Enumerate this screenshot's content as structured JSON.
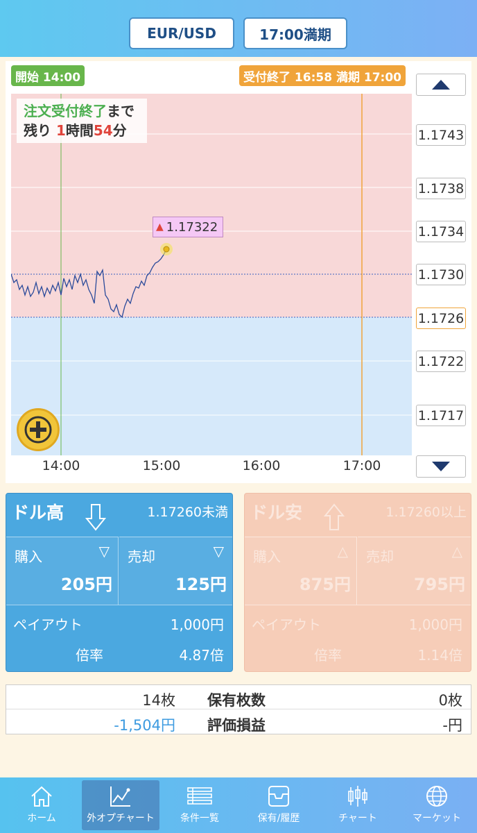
{
  "header": {
    "pair": "EUR/USD",
    "expiry": "17:00満期"
  },
  "chart": {
    "start_flag": "開始 14:00",
    "end_flag": "受付終了 16:58 満期 17:00",
    "remaining": {
      "part1": "注文受付終了",
      "part2": "まで",
      "part3": "残り",
      "hours": "1",
      "hours_unit": "時間",
      "minutes": "54",
      "minutes_unit": "分"
    },
    "current_price": "1.17322",
    "y_labels": [
      "1.1743",
      "1.1738",
      "1.1734",
      "1.1730",
      "1.1726",
      "1.1722",
      "1.1717"
    ],
    "x_labels": [
      "14:00",
      "15:00",
      "16:00",
      "17:00"
    ],
    "colors": {
      "above": "#f8d8d8",
      "below": "#d6e9fa",
      "line": "#2a4a9a",
      "start": "#68b64b",
      "end": "#f0a43a"
    }
  },
  "options": {
    "high": {
      "title": "ドル高",
      "condition": "1.17260未満",
      "buy_label": "購入",
      "buy_price": "205円",
      "sell_label": "売却",
      "sell_price": "125円",
      "payout_label": "ペイアウト",
      "payout_value": "1,000円",
      "ratio_label": "倍率",
      "ratio_value": "4.87倍"
    },
    "low": {
      "title": "ドル安",
      "condition": "1.17260以上",
      "buy_label": "購入",
      "buy_price": "875円",
      "sell_label": "売却",
      "sell_price": "795円",
      "payout_label": "ペイアウト",
      "payout_value": "1,000円",
      "ratio_label": "倍率",
      "ratio_value": "1.14倍"
    }
  },
  "holdings": {
    "left_count": "14枚",
    "count_label": "保有枚数",
    "right_count": "0枚",
    "left_pl": "-1,504円",
    "pl_label": "評価損益",
    "right_pl": "-円"
  },
  "nav": [
    {
      "label": "ホーム",
      "icon": "home-icon"
    },
    {
      "label": "外オプチャート",
      "icon": "chart-line-icon"
    },
    {
      "label": "条件一覧",
      "icon": "list-icon"
    },
    {
      "label": "保有/履歴",
      "icon": "tray-icon"
    },
    {
      "label": "チャート",
      "icon": "candlestick-icon"
    },
    {
      "label": "マーケット",
      "icon": "globe-icon"
    }
  ]
}
